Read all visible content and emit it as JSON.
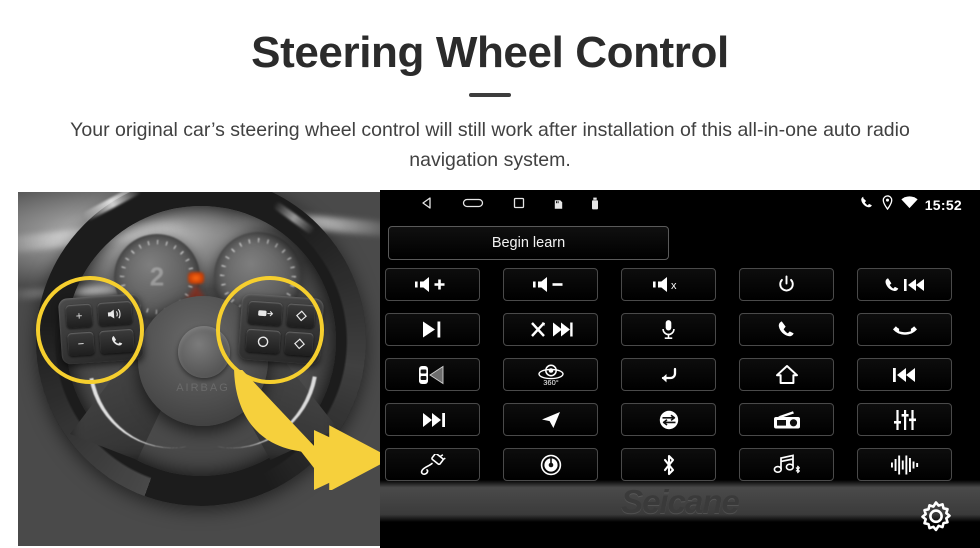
{
  "header": {
    "title": "Steering Wheel Control",
    "subtitle": "Your original car’s steering wheel control will still work after installation of this all-in-one auto radio navigation system."
  },
  "photo": {
    "alt_name": "steering-wheel-photo",
    "gauge_left_number": "2",
    "hub_logo": "AIRBAG",
    "highlight_color": "#f6cf2e",
    "arrow_color": "#f6d03c",
    "left_pad_keys": [
      "+",
      "−",
      "voice",
      "call"
    ],
    "right_pad_keys": [
      "mode",
      "enter",
      "up",
      "down"
    ]
  },
  "unit": {
    "statusbar": {
      "nav": [
        {
          "name": "back-icon",
          "label": "back"
        },
        {
          "name": "home-icon",
          "label": "home"
        },
        {
          "name": "recents-icon",
          "label": "recents"
        },
        {
          "name": "sdcard-icon",
          "label": "sd card"
        },
        {
          "name": "usb-icon",
          "label": "usb"
        }
      ],
      "system": [
        {
          "name": "phone-icon",
          "label": "phone"
        },
        {
          "name": "location-pin-icon",
          "label": "location"
        },
        {
          "name": "wifi-icon",
          "label": "wifi"
        }
      ],
      "clock": "15:52"
    },
    "begin_learn_label": "Begin learn",
    "watermark": "Seicane",
    "settings_icon": "gear-icon",
    "buttons": [
      {
        "id": "vol-up",
        "icon": "volume-up-icon",
        "label": "Volume +"
      },
      {
        "id": "vol-down",
        "icon": "volume-down-icon",
        "label": "Volume −"
      },
      {
        "id": "mute",
        "icon": "volume-mute-icon",
        "label": "Mute"
      },
      {
        "id": "power",
        "icon": "power-icon",
        "label": "Power"
      },
      {
        "id": "call-prev",
        "icon": "call-previous-icon",
        "label": "Call / Previous"
      },
      {
        "id": "play-pause",
        "icon": "play-pause-icon",
        "label": "Play / Pause"
      },
      {
        "id": "shuffle-next",
        "icon": "shuffle-next-icon",
        "label": "Shuffle / Next"
      },
      {
        "id": "voice",
        "icon": "microphone-icon",
        "label": "Voice"
      },
      {
        "id": "answer-call",
        "icon": "phone-answer-icon",
        "label": "Answer Call"
      },
      {
        "id": "end-call",
        "icon": "phone-hangup-icon",
        "label": "End Call"
      },
      {
        "id": "parking-sensor",
        "icon": "parking-radar-icon",
        "label": "Parking Radar"
      },
      {
        "id": "cam360",
        "icon": "camera-360-icon",
        "label": "360° Camera"
      },
      {
        "id": "back",
        "icon": "return-arrow-icon",
        "label": "Back"
      },
      {
        "id": "home",
        "icon": "house-icon",
        "label": "Home"
      },
      {
        "id": "prev-track",
        "icon": "previous-track-icon",
        "label": "Previous Track"
      },
      {
        "id": "next-track",
        "icon": "next-track-icon",
        "label": "Next Track"
      },
      {
        "id": "navigation",
        "icon": "navigation-arrow-icon",
        "label": "Navigation"
      },
      {
        "id": "mode",
        "icon": "mode-swap-icon",
        "label": "Mode"
      },
      {
        "id": "radio",
        "icon": "radio-icon",
        "label": "Radio"
      },
      {
        "id": "equalizer",
        "icon": "equalizer-icon",
        "label": "Equalizer"
      },
      {
        "id": "usb",
        "icon": "usb-cable-icon",
        "label": "USB"
      },
      {
        "id": "disc",
        "icon": "disc-icon",
        "label": "Disc"
      },
      {
        "id": "bluetooth",
        "icon": "bluetooth-icon",
        "label": "Bluetooth"
      },
      {
        "id": "bt-music",
        "icon": "bluetooth-music-icon",
        "label": "Bluetooth Music"
      },
      {
        "id": "sound-wave",
        "icon": "sound-wave-icon",
        "label": "Sound"
      }
    ]
  }
}
